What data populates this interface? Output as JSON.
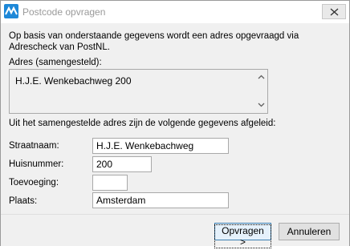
{
  "window": {
    "title": "Postcode opvragen",
    "icons": {
      "app": "app-logo-icon",
      "close": "close-icon"
    }
  },
  "intro": {
    "text": "Op basis van onderstaande gegevens wordt een adres opgevraagd via Adrescheck van PostNL."
  },
  "address": {
    "label": "Adres (samengesteld):",
    "value": "H.J.E. Wenkebachweg 200",
    "scroll_icons": [
      "chevron-up-icon",
      "chevron-down-icon"
    ]
  },
  "derived": {
    "label": "Uit het samengestelde adres zijn de volgende gegevens afgeleid:"
  },
  "fields": {
    "street": {
      "label": "Straatnaam:",
      "value": "H.J.E. Wenkebachweg"
    },
    "number": {
      "label": "Huisnummer:",
      "value": "200"
    },
    "addition": {
      "label": "Toevoeging:",
      "value": ""
    },
    "city": {
      "label": "Plaats:",
      "value": "Amsterdam"
    }
  },
  "buttons": {
    "request": "Opvragen >",
    "cancel": "Annuleren"
  },
  "colors": {
    "accent": "#1e88d8",
    "background": "#f0f0f0",
    "title_text": "#9a9a9a"
  }
}
